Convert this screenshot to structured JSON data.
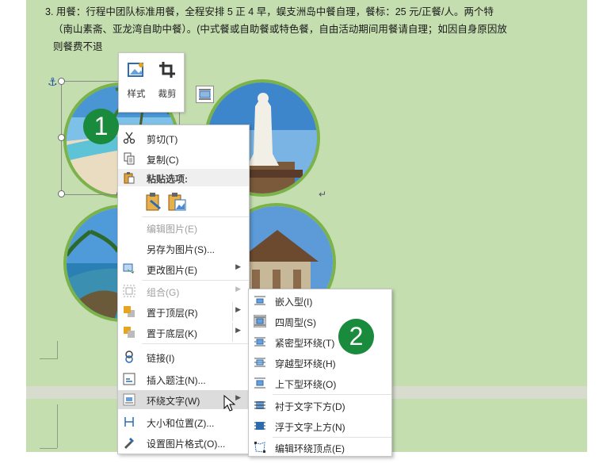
{
  "document": {
    "paragraph_lines": [
      "3. 用餐：行程中团队标准用餐，全程安排 5 正 4 早，蜈支洲岛中餐自理，餐标：25 元/正餐/人。两个特",
      "（南山素斋、亚龙湾自助中餐）。(中式餐或自助餐或特色餐，自由活动期间用餐请自理；如因自身原因放",
      "则餐费不退"
    ],
    "anchor_glyph": "⚓",
    "return_mark": "↵"
  },
  "mini_toolbar": {
    "style_label": "样式",
    "crop_label": "裁剪"
  },
  "badges": {
    "first": "1",
    "second": "2"
  },
  "context_menu": {
    "cut": "剪切(T)",
    "copy": "复制(C)",
    "paste_options": "粘贴选项:",
    "edit_picture": "编辑图片(E)",
    "save_as_picture": "另存为图片(S)...",
    "change_picture": "更改图片(E)",
    "group": "组合(G)",
    "bring_to_front": "置于顶层(R)",
    "send_to_back": "置于底层(K)",
    "link": "链接(I)",
    "insert_caption": "插入题注(N)...",
    "wrap_text": "环绕文字(W)",
    "size_position": "大小和位置(Z)...",
    "format_picture": "设置图片格式(O)..."
  },
  "wrap_submenu": {
    "inline": "嵌入型(I)",
    "square": "四周型(S)",
    "tight": "紧密型环绕(T)",
    "through": "穿越型环绕(H)",
    "top_bottom": "上下型环绕(O)",
    "behind_text": "衬于文字下方(D)",
    "in_front_of_text": "浮于文字上方(N)",
    "edit_wrap_points": "编辑环绕顶点(E)"
  },
  "colors": {
    "page_background": "#c4deb0",
    "circle_border": "#7bb24a",
    "badge": "#1a8a3c",
    "menu_highlight": "#dcdcdc"
  }
}
